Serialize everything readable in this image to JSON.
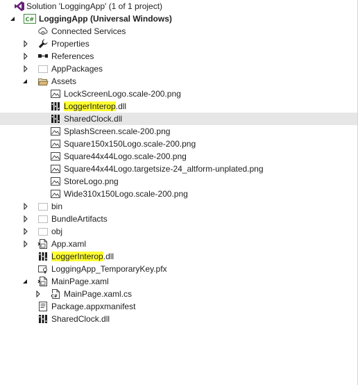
{
  "solution_explorer": {
    "solution_label": "Solution 'LoggingApp' (1 of 1 project)",
    "project_label": "LoggingApp (Universal Windows)",
    "project_badge": "C#",
    "colors": {
      "selection": "#e6e6e6",
      "highlight": "#ffff33",
      "csharp_project": "#388a34",
      "vs_purple": "#68217a"
    },
    "items": {
      "connected_services": "Connected Services",
      "properties": "Properties",
      "references": "References",
      "app_packages": "AppPackages",
      "assets": "Assets",
      "asset_lockscreen": "LockScreenLogo.scale-200.png",
      "asset_loggerinterop_name": "LoggerInterop",
      "asset_loggerinterop_ext": ".dll",
      "asset_sharedclock": "SharedClock.dll",
      "asset_splash": "SplashScreen.scale-200.png",
      "asset_square150": "Square150x150Logo.scale-200.png",
      "asset_square44": "Square44x44Logo.scale-200.png",
      "asset_square44_target": "Square44x44Logo.targetsize-24_altform-unplated.png",
      "asset_storelogo": "StoreLogo.png",
      "asset_wide310": "Wide310x150Logo.scale-200.png",
      "bin": "bin",
      "bundle_artifacts": "BundleArtifacts",
      "obj": "obj",
      "app_xaml": "App.xaml",
      "loggerinterop_name": "LoggerInterop",
      "loggerinterop_ext": ".dll",
      "temporary_key": "LoggingApp_TemporaryKey.pfx",
      "mainpage_xaml": "MainPage.xaml",
      "mainpage_cs": "MainPage.xaml.cs",
      "package_manifest": "Package.appxmanifest",
      "sharedclock": "SharedClock.dll"
    }
  }
}
